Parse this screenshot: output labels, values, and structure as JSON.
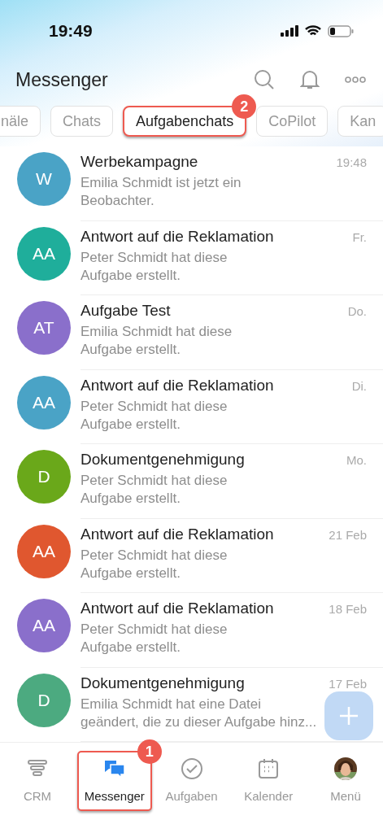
{
  "status_bar": {
    "time": "19:49"
  },
  "header": {
    "title": "Messenger"
  },
  "tabs": [
    {
      "label": "näle",
      "selected": false
    },
    {
      "label": "Chats",
      "selected": false
    },
    {
      "label": "Aufgabenchats",
      "selected": true,
      "callout": "2"
    },
    {
      "label": "CoPilot",
      "selected": false
    },
    {
      "label": "Kan",
      "selected": false
    }
  ],
  "chats": [
    {
      "initials": "W",
      "color": "#4aa3c6",
      "title": "Werbekampagne",
      "preview": [
        "Emilia Schmidt ist jetzt ein",
        "Beobachter."
      ],
      "time": "19:48"
    },
    {
      "initials": "AA",
      "color": "#1fae9b",
      "title": "Antwort auf die Reklamation",
      "preview": [
        "Peter Schmidt hat diese",
        "Aufgabe erstellt."
      ],
      "time": "Fr."
    },
    {
      "initials": "AT",
      "color": "#8a6fcb",
      "title": "Aufgabe Test",
      "preview": [
        "Emilia Schmidt hat diese",
        "Aufgabe erstellt."
      ],
      "time": "Do."
    },
    {
      "initials": "AA",
      "color": "#4aa3c6",
      "title": "Antwort auf die Reklamation",
      "preview": [
        "Peter Schmidt hat diese",
        "Aufgabe erstellt."
      ],
      "time": "Di."
    },
    {
      "initials": "D",
      "color": "#6aa81a",
      "title": "Dokumentgenehmigung",
      "preview": [
        "Peter Schmidt hat diese",
        "Aufgabe erstellt."
      ],
      "time": "Mo."
    },
    {
      "initials": "AA",
      "color": "#e0572f",
      "title": "Antwort auf die Reklamation",
      "preview": [
        "Peter Schmidt hat diese",
        "Aufgabe erstellt."
      ],
      "time": "21 Feb"
    },
    {
      "initials": "AA",
      "color": "#8a6fcb",
      "title": "Antwort auf die Reklamation",
      "preview": [
        "Peter Schmidt hat diese",
        "Aufgabe erstellt."
      ],
      "time": "18 Feb"
    },
    {
      "initials": "D",
      "color": "#4caa80",
      "title": "Dokumentgenehmigung",
      "preview": [
        "Emilia Schmidt hat eine Datei",
        "geändert, die zu dieser Aufgabe hinz..."
      ],
      "time": "17 Feb"
    }
  ],
  "nav": [
    {
      "kind": "crm",
      "label": "CRM",
      "selected": false
    },
    {
      "kind": "messenger",
      "label": "Messenger",
      "selected": true,
      "callout": "1"
    },
    {
      "kind": "tasks",
      "label": "Aufgaben",
      "selected": false
    },
    {
      "kind": "calendar",
      "label": "Kalender",
      "selected": false
    },
    {
      "kind": "avatar",
      "label": "Menü",
      "selected": false
    }
  ]
}
